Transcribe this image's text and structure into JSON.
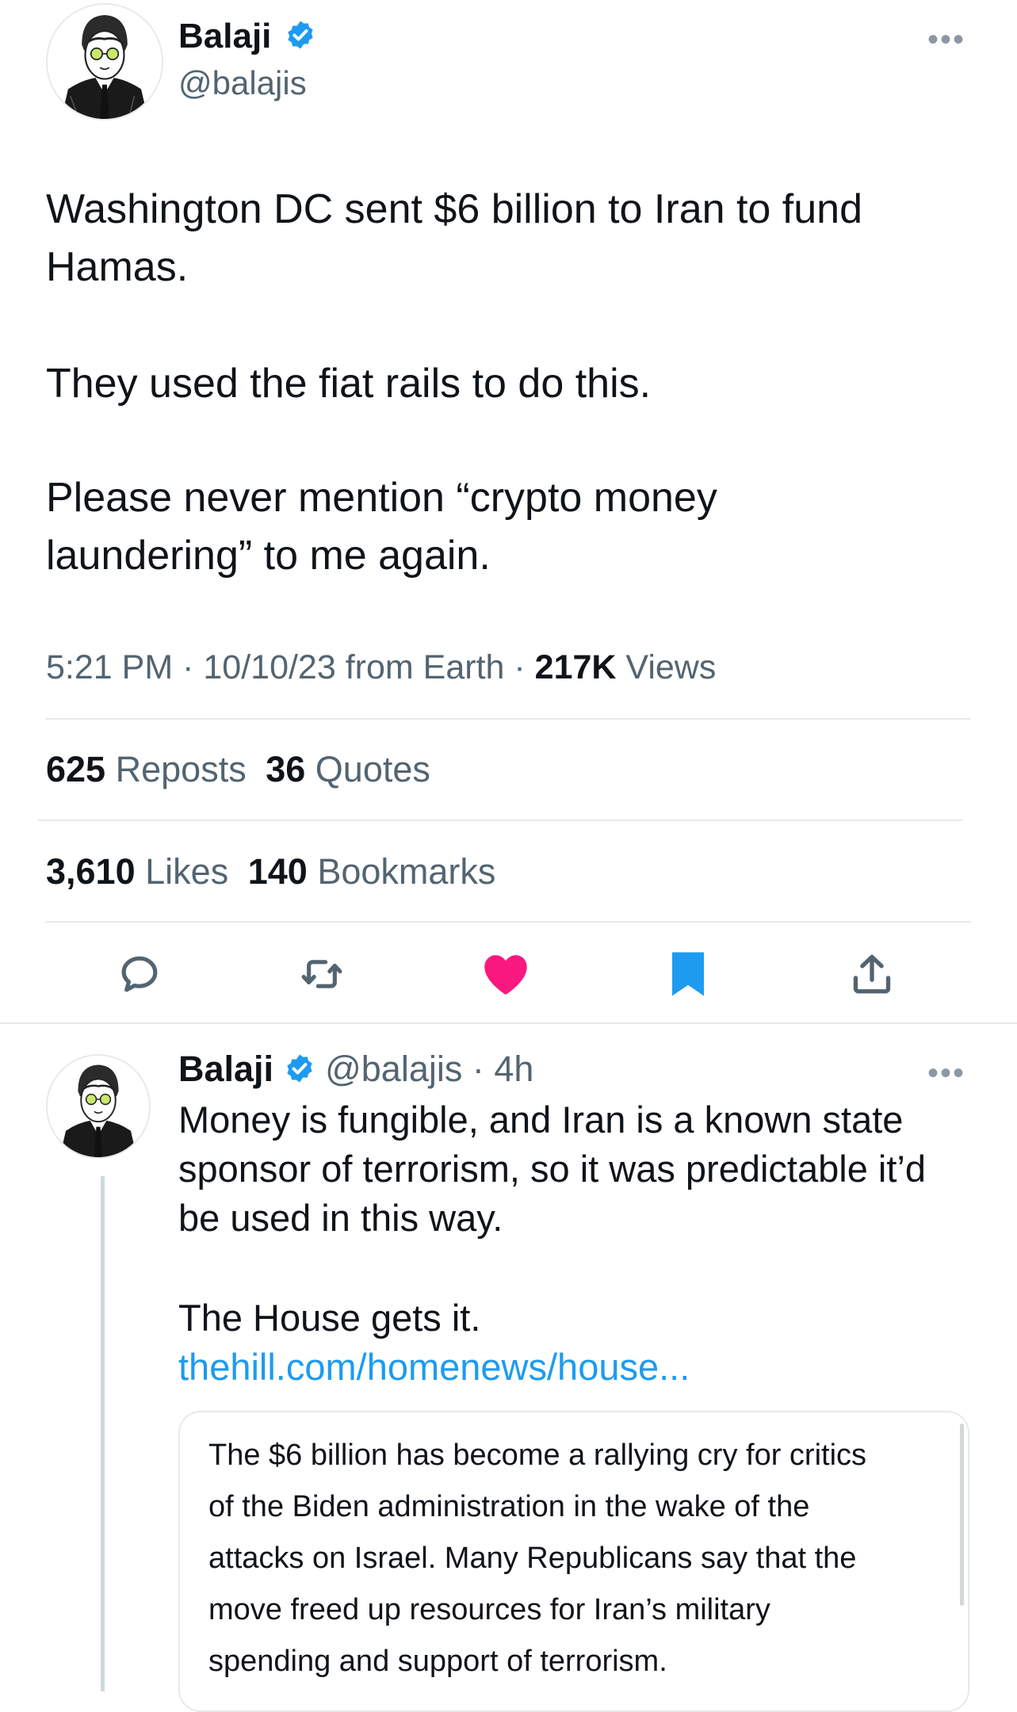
{
  "main_tweet": {
    "author_name": "Balaji",
    "handle": "@balajis",
    "more_icon": "more-horizontal-icon",
    "text_p1_l1": "Washington DC sent $6 billion to Iran to fund",
    "text_p1_l2": "Hamas.",
    "text_p2": "They used the fiat rails to do this.",
    "text_p3_l1": "Please never mention “crypto money",
    "text_p3_l2": "laundering” to me again.",
    "time": "5:21 PM",
    "sep": "·",
    "date_source": "10/10/23 from Earth",
    "views_count": "217K",
    "views_label": "Views",
    "reposts_count": "625",
    "reposts_label": "Reposts",
    "quotes_count": "36",
    "quotes_label": "Quotes",
    "likes_count": "3,610",
    "likes_label": "Likes",
    "bookmarks_count": "140",
    "bookmarks_label": "Bookmarks"
  },
  "actions": {
    "reply_icon": "reply-icon",
    "repost_icon": "repost-icon",
    "like_icon": "heart-filled-icon",
    "bookmark_icon": "bookmark-filled-icon",
    "share_icon": "share-icon",
    "like_color": "#f91880",
    "bookmark_color": "#1d9bf0"
  },
  "reply_tweet": {
    "author_name": "Balaji",
    "handle": "@balajis",
    "time_ago": "· 4h",
    "text_l1": "Money is fungible, and Iran is a known state",
    "text_l2": "sponsor of terrorism, so it was predictable it’d",
    "text_l3": "be used in this way.",
    "text_l4": "The House gets it.",
    "link": "thehill.com/homenews/house...",
    "card_l1": "The $6 billion has become a rallying cry for critics",
    "card_l2": "of the Biden administration in the wake of the",
    "card_l3": "attacks on Israel. Many Republicans say that the",
    "card_l4": "move freed up resources for Iran’s military",
    "card_l5": "spending and support of terrorism."
  }
}
